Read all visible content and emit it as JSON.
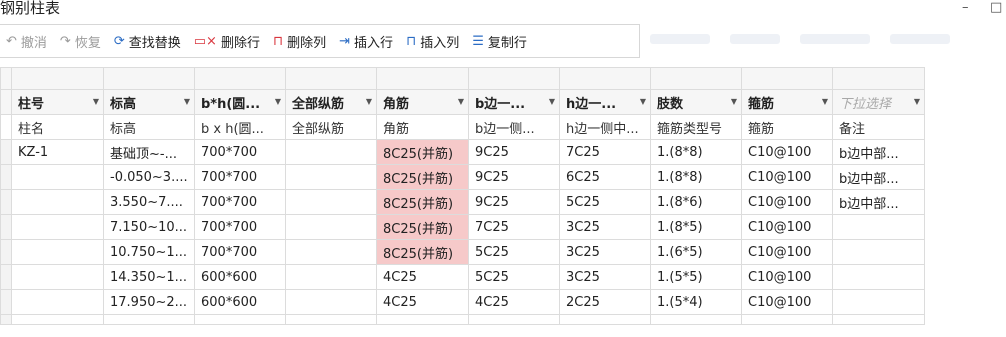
{
  "window": {
    "title": "钢别柱表",
    "minimize_label": "–",
    "restore_label": "□"
  },
  "toolbar": {
    "undo": "撤消",
    "redo": "恢复",
    "find_replace": "查找替换",
    "delete_row": "删除行",
    "delete_col": "删除列",
    "insert_row": "插入行",
    "insert_col": "插入列",
    "copy_row": "复制行"
  },
  "columns": [
    "柱号",
    "标高",
    "b*h(圆...",
    "全部纵筋",
    "角筋",
    "b边一...",
    "h边一...",
    "肢数",
    "箍筋",
    "下拉选择"
  ],
  "subheaders": [
    "柱名",
    "标高",
    "b x h(圆...",
    "全部纵筋",
    "角筋",
    "b边一侧...",
    "h边一侧中...",
    "箍筋类型号",
    "箍筋",
    "备注"
  ],
  "rows": [
    [
      "KZ-1",
      "基础顶~-...",
      "700*700",
      "",
      "8C25(并筋)",
      "9C25",
      "7C25",
      "1.(8*8)",
      "C10@100",
      "b边中部..."
    ],
    [
      "",
      "-0.050~3....",
      "700*700",
      "",
      "8C25(并筋)",
      "9C25",
      "6C25",
      "1.(8*8)",
      "C10@100",
      "b边中部..."
    ],
    [
      "",
      "3.550~7....",
      "700*700",
      "",
      "8C25(并筋)",
      "9C25",
      "5C25",
      "1.(8*6)",
      "C10@100",
      "b边中部..."
    ],
    [
      "",
      "7.150~10...",
      "700*700",
      "",
      "8C25(并筋)",
      "7C25",
      "3C25",
      "1.(8*5)",
      "C10@100",
      ""
    ],
    [
      "",
      "10.750~1...",
      "700*700",
      "",
      "8C25(并筋)",
      "5C25",
      "3C25",
      "1.(6*5)",
      "C10@100",
      ""
    ],
    [
      "",
      "14.350~1...",
      "600*600",
      "",
      "4C25",
      "5C25",
      "3C25",
      "1.(5*5)",
      "C10@100",
      ""
    ],
    [
      "",
      "17.950~2...",
      "600*600",
      "",
      "4C25",
      "4C25",
      "2C25",
      "1.(5*4)",
      "C10@100",
      ""
    ]
  ],
  "colors": {
    "highlight": "#f6c9c9",
    "grid_line": "#dcdcdc",
    "header_bg": "#f6f6f6"
  }
}
